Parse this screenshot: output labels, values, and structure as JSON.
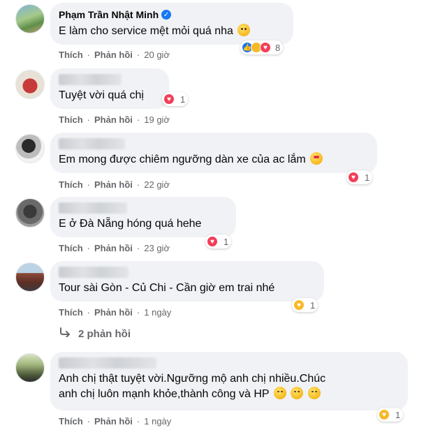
{
  "comments": [
    {
      "name": "Phạm Trần Nhật Minh",
      "verified": true,
      "text": "E làm cho service mệt mỏi quá nha",
      "like_label": "Thích",
      "reply_label": "Phản hồi",
      "time": "20 giờ",
      "reaction_count": "8",
      "reactions": [
        "like-icon",
        "haha-icon",
        "love-icon"
      ]
    },
    {
      "text": "Tuyệt vời quá chị",
      "like_label": "Thích",
      "reply_label": "Phản hồi",
      "time": "19 giờ",
      "reaction_count": "1",
      "reactions": [
        "love-icon"
      ]
    },
    {
      "text": "Em mong được chiêm ngưỡng dàn xe của ac lắm",
      "like_label": "Thích",
      "reply_label": "Phản hồi",
      "time": "22 giờ",
      "reaction_count": "1",
      "reactions": [
        "love-icon"
      ]
    },
    {
      "text": "E ở Đà Nẵng hóng quá hehe",
      "like_label": "Thích",
      "reply_label": "Phản hồi",
      "time": "23 giờ",
      "reaction_count": "1",
      "reactions": [
        "love-icon"
      ]
    },
    {
      "text": "Tour sài Gòn - Củ Chi - Cần giờ em trai nhé",
      "like_label": "Thích",
      "reply_label": "Phản hồi",
      "time": "1 ngày",
      "reaction_count": "1",
      "reactions": [
        "care-icon"
      ],
      "view_replies": "2 phản hồi"
    },
    {
      "text_line1": "Anh chị thật tuyệt vời.Ngưỡng mộ anh chị nhiều.Chúc",
      "text_line2": "anh chị luôn mạnh khỏe,thành công và HP",
      "like_label": "Thích",
      "reply_label": "Phản hồi",
      "time": "1 ngày",
      "reaction_count": "1",
      "reactions": [
        "care-icon"
      ]
    }
  ],
  "colors": {
    "bubble": "#f0f2f5",
    "meta": "#65676b",
    "like": "#1877f2",
    "love": "#f33e58"
  }
}
